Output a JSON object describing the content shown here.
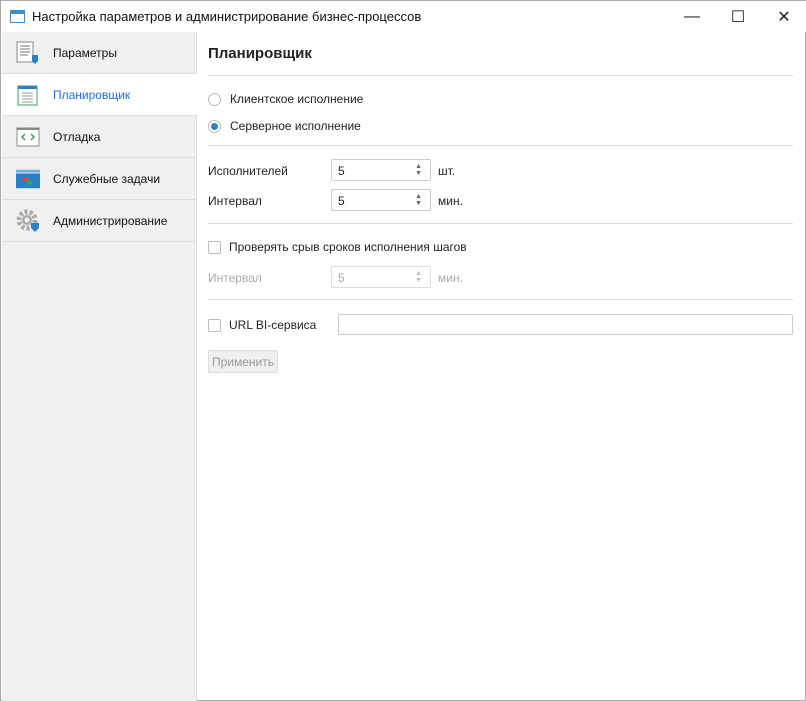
{
  "window": {
    "title": "Настройка параметров и администрирование бизнес-процессов",
    "minimize": "—",
    "maximize": "☐",
    "close": "✕"
  },
  "sidebar": {
    "items": [
      {
        "label": "Параметры",
        "icon": "settings-list-icon"
      },
      {
        "label": "Планировщик",
        "icon": "calendar-icon"
      },
      {
        "label": "Отладка",
        "icon": "code-icon"
      },
      {
        "label": "Служебные задачи",
        "icon": "tasks-icon"
      },
      {
        "label": "Администрирование",
        "icon": "gear-shield-icon"
      }
    ],
    "active": 1
  },
  "main": {
    "title": "Планировщик",
    "radio_client": "Клиентское исполнение",
    "radio_server": "Серверное исполнение",
    "selected": "server",
    "executors": {
      "label": "Исполнителей",
      "value": "5",
      "unit": "шт."
    },
    "interval": {
      "label": "Интервал",
      "value": "5",
      "unit": "мин."
    },
    "check_deadline": {
      "label": "Проверять срыв сроков исполнения шагов",
      "checked": false
    },
    "deadline_interval": {
      "label": "Интервал",
      "value": "5",
      "unit": "мин."
    },
    "url": {
      "label": "URL BI-сервиса",
      "checked": false,
      "value": ""
    },
    "apply": "Применить"
  },
  "colors": {
    "accent": "#1a73e8",
    "radio": "#2a7fc9"
  }
}
